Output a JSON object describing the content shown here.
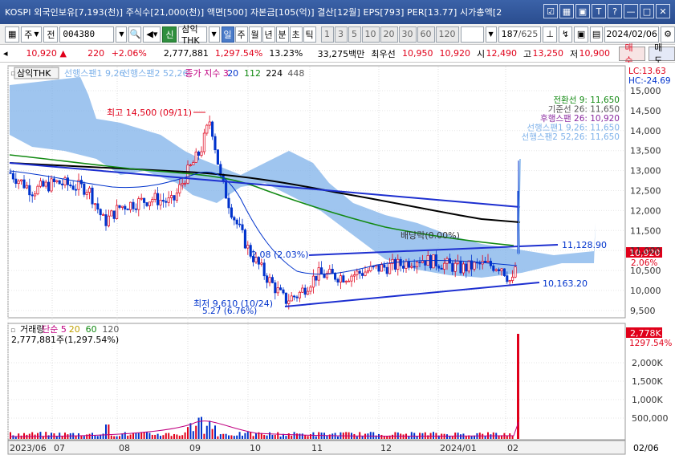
{
  "window": {
    "title": "KOSPI 외국인보유[7,193(천)] 주식수[21,000(천)] 액면[500] 자본금[105(억)] 결산[12월] EPS[793] PER[13.77] 시가총액[2"
  },
  "toolbar": {
    "market": "주",
    "prev_label": "전",
    "code": "004380",
    "tag_label": "신",
    "stock_name": "삼익THK",
    "periods": [
      "일",
      "주",
      "월",
      "년",
      "분",
      "초",
      "틱"
    ],
    "active_period": "일",
    "intervals": [
      "1",
      "3",
      "5",
      "10",
      "20",
      "30",
      "60",
      "120"
    ],
    "count": "187",
    "total": "/625",
    "date": "2024/02/06"
  },
  "quote": {
    "price": "10,920",
    "arrow": "▲",
    "change": "220",
    "change_pct": "+2.06%",
    "volume": "2,777,881",
    "volume_pct": "1,297.54%",
    "turnover": "13.23%",
    "amount": "33,275백만",
    "priority_label": "최우선",
    "ask": "10,950",
    "bid": "10,920",
    "open_label": "시",
    "open": "12,490",
    "high_label": "고",
    "high": "13,250",
    "low_label": "저",
    "low": "10,900",
    "buy_label": "매수",
    "sell_label": "매도"
  },
  "price_panel": {
    "name_tag": "삼익THK",
    "legend": [
      {
        "label": "선행스팬1 9,26",
        "color": "#7fb2ea"
      },
      {
        "label": "선행스팬2 52,26",
        "color": "#7fb2ea"
      },
      {
        "label": "종가 지수 3",
        "color": "#c00080"
      },
      {
        "label": "20",
        "color": "#0033cc"
      },
      {
        "label": "112",
        "color": "#138a13"
      },
      {
        "label": "224",
        "color": "#000000"
      },
      {
        "label": "448",
        "color": "#555555"
      }
    ],
    "lc": "LC:13.63",
    "hc": "HC:-24.69",
    "ichimoku": [
      {
        "label": "전환선 9: 11,650",
        "color": "#138a13"
      },
      {
        "label": "기준선 26: 11,650",
        "color": "#555555"
      },
      {
        "label": "후행스팬 26: 10,920",
        "color": "#8a2aa0"
      },
      {
        "label": "선행스팬1 9,26: 11,650",
        "color": "#7fb2ea"
      },
      {
        "label": "선행스팬2 52,26: 11,650",
        "color": "#7fb2ea"
      }
    ],
    "annotations": {
      "high": "최고 14,500 (09/11)",
      "low": "최저 9,610 (10/24)",
      "low_pct": "5.27 (6.76%)",
      "mid_pct": "2.08 (2.03%)",
      "dividend": "배당락(0.00%)",
      "line_upper": "11,128.90",
      "line_lower": "10,163.20"
    },
    "price_label": "10,920",
    "price_pct": "2.06%",
    "y_ticks": [
      "15,000",
      "14,500",
      "14,000",
      "13,500",
      "13,000",
      "12,500",
      "12,000",
      "11,500",
      "11,000",
      "10,500",
      "10,000",
      "9,500"
    ]
  },
  "volume_panel": {
    "legend": [
      {
        "label": "거래량",
        "color": "#000000"
      },
      {
        "label": "단순 5",
        "color": "#c00080"
      },
      {
        "label": "20",
        "color": "#c0a000"
      },
      {
        "label": "60",
        "color": "#138a13"
      },
      {
        "label": "120",
        "color": "#555555"
      }
    ],
    "value": "2,777,881주(1,297.54%)",
    "vol_label": "2,778K",
    "vol_pct": "1297.54%",
    "y_ticks": [
      "2,000K",
      "1,500K",
      "1,000K",
      "500,000"
    ]
  },
  "x_axis": {
    "labels": [
      "2023/06",
      "07",
      "08",
      "09",
      "10",
      "11",
      "12",
      "2024/01",
      "02"
    ],
    "right_label": "02/06"
  }
}
